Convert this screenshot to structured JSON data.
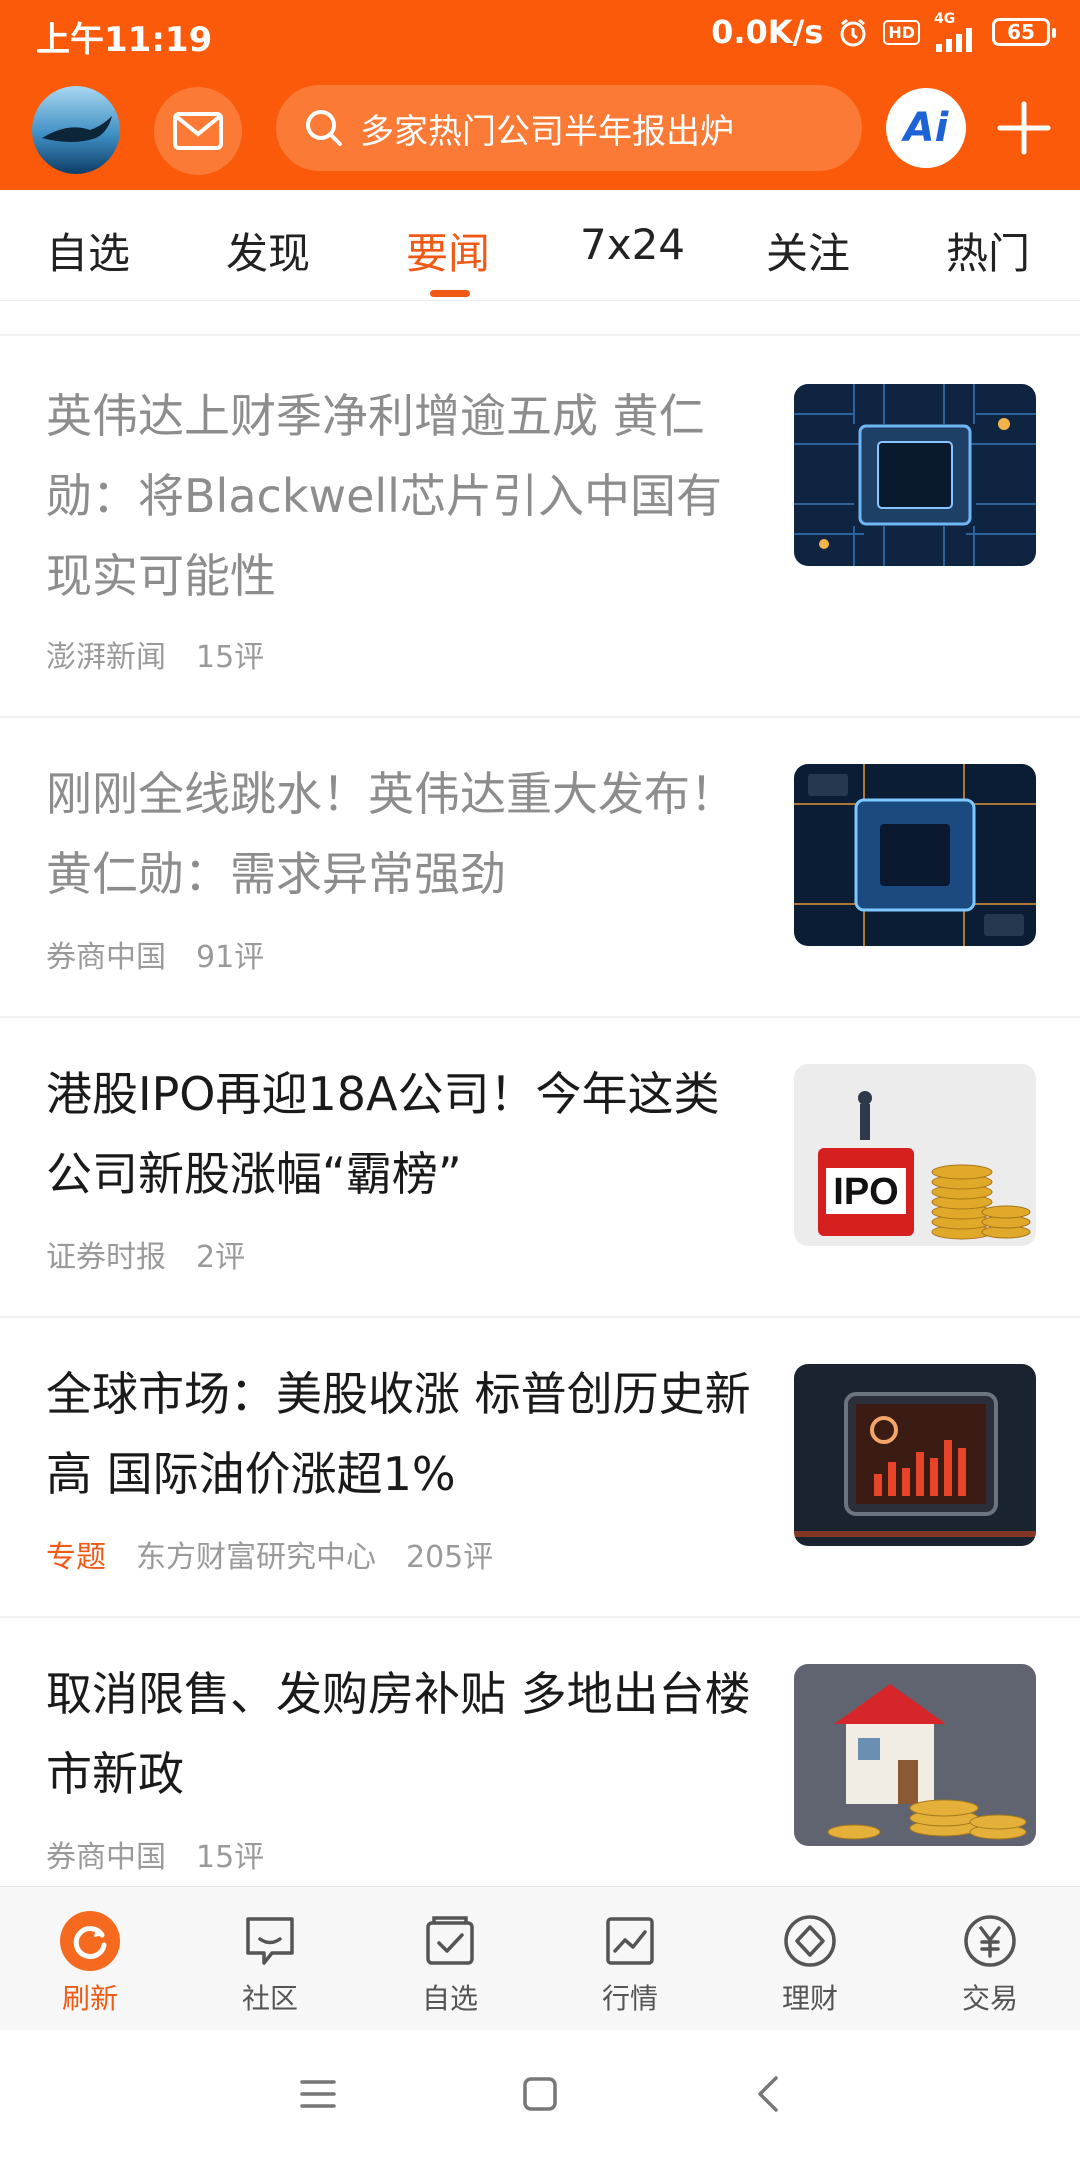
{
  "status_bar": {
    "time": "上午11:19",
    "net_speed": "0.0K/s",
    "hd": "HD",
    "network": "4G",
    "battery": "65"
  },
  "header": {
    "search_placeholder": "多家热门公司半年报出炉",
    "ai_label": "Ai"
  },
  "tabs": [
    "自选",
    "发现",
    "要闻",
    "7x24",
    "关注",
    "热门"
  ],
  "active_tab": "要闻",
  "articles": [
    {
      "title": "英伟达上财季净利增逾五成 黄仁勋：将Blackwell芯片引入中国有现实可能性",
      "source": "澎湃新闻",
      "comments": "15评",
      "read": true,
      "image": "chip-image"
    },
    {
      "title": "刚刚全线跳水！英伟达重大发布！黄仁勋：需求异常强劲",
      "source": "券商中国",
      "comments": "91评",
      "read": true,
      "image": "chip-image"
    },
    {
      "title": "港股IPO再迎18A公司！今年这类公司新股涨幅“霸榜”",
      "source": "证券时报",
      "comments": "2评",
      "read": false,
      "image": "ipo-image"
    },
    {
      "title": "全球市场：美股收涨 标普创历史新高 国际油价涨超1%",
      "topic": "专题",
      "source": "东方财富研究中心",
      "comments": "205评",
      "read": false,
      "image": "market-tablet-image"
    },
    {
      "title": "取消限售、发购房补贴 多地出台楼市新政",
      "source": "券商中国",
      "comments": "15评",
      "read": false,
      "image": "house-coins-image"
    }
  ],
  "thumb_text": {
    "ipo": "IPO"
  },
  "bottom_nav": [
    {
      "label": "刷新",
      "icon": "refresh-icon",
      "active": true
    },
    {
      "label": "社区",
      "icon": "chat-bubble-icon",
      "active": false
    },
    {
      "label": "自选",
      "icon": "checkbox-icon",
      "active": false
    },
    {
      "label": "行情",
      "icon": "line-chart-icon",
      "active": false
    },
    {
      "label": "理财",
      "icon": "diamond-icon",
      "active": false
    },
    {
      "label": "交易",
      "icon": "yen-icon",
      "active": false
    }
  ],
  "colors": {
    "brand_orange": "#fa5a0a",
    "accent": "#f05a14",
    "text": "#1a1a1a",
    "read_text": "#8d8d8d",
    "meta": "#9a9a9a"
  }
}
